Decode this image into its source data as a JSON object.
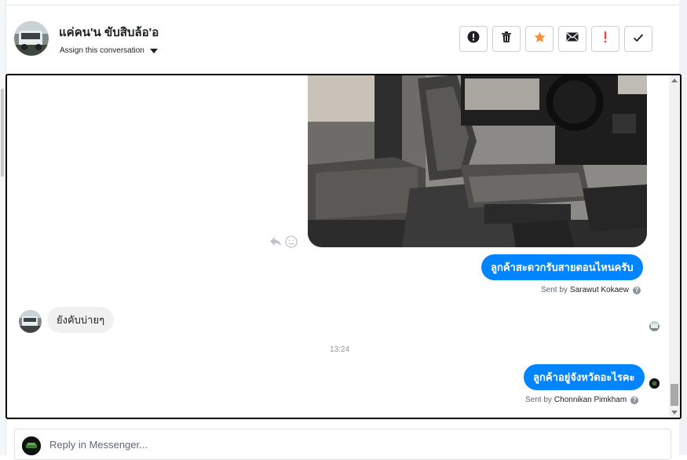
{
  "header": {
    "contact_name": "แค่คน'น ขับสิบล้อ'อ",
    "assign_label": "Assign this conversation",
    "toolbar": [
      {
        "name": "mark-spam-button",
        "icon": "alert-circle-icon"
      },
      {
        "name": "delete-button",
        "icon": "trash-icon"
      },
      {
        "name": "star-button",
        "icon": "star-icon"
      },
      {
        "name": "mark-unread-button",
        "icon": "envelope-icon"
      },
      {
        "name": "mark-important-button",
        "icon": "exclamation-icon"
      },
      {
        "name": "mark-done-button",
        "icon": "checkmark-icon"
      }
    ]
  },
  "thread": {
    "messages": [
      {
        "type": "outgoing",
        "text": "ลูกค้าสะดวกรับสายตอนไหนครับ",
        "sent_by_prefix": "Sent by",
        "sent_by_name": "Sarawut Kokaew"
      },
      {
        "type": "incoming",
        "text": "ยังคับบ่ายๆ"
      },
      {
        "type": "timestamp",
        "text": "13:24"
      },
      {
        "type": "outgoing",
        "text": "ลูกค้าอยู่จังหวัดอะไรคะ",
        "sent_by_prefix": "Sent by",
        "sent_by_name": "Chonnikan Pimkham"
      }
    ]
  },
  "reply": {
    "placeholder": "Reply in Messenger..."
  },
  "colors": {
    "accent_blue": "#0084ff",
    "star_orange": "#f7923a",
    "important_red": "#fa3e3e",
    "incoming_bubble": "#f1f0f0"
  }
}
